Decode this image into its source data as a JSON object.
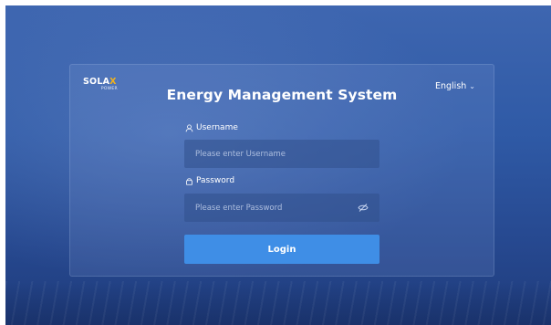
{
  "brand": {
    "logo_main_prefix": "SOLA",
    "logo_main_x": "X",
    "logo_sub": "POWER"
  },
  "language": {
    "selected": "English",
    "icon": "chevron-down-icon"
  },
  "login": {
    "title": "Energy Management System",
    "username_label": "Username",
    "username_placeholder": "Please enter Username",
    "username_value": "",
    "password_label": "Password",
    "password_placeholder": "Please enter Password",
    "password_value": "",
    "login_button": "Login"
  },
  "icons": {
    "username": "user-icon",
    "password": "lock-icon",
    "password_visibility": "eye-off-icon"
  },
  "colors": {
    "background": "#2f5aa6",
    "button": "#3f8ee6",
    "logo_accent": "#f2b21b"
  }
}
